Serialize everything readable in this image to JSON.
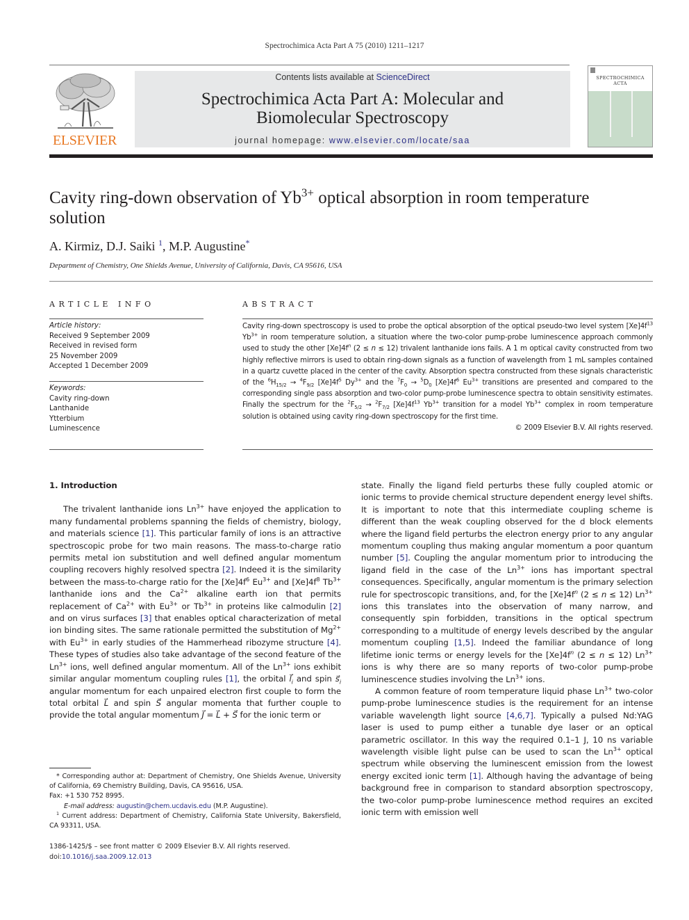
{
  "header": {
    "citation": "Spectrochimica Acta Part A 75 (2010) 1211–1217",
    "publisher_logo_text": "ELSEVIER",
    "contents_prefix": "Contents lists available at ",
    "contents_link": "ScienceDirect",
    "journal_title_line1": "Spectrochimica Acta Part A: Molecular and",
    "journal_title_line2": "Biomolecular Spectroscopy",
    "homepage_prefix": "journal homepage: ",
    "homepage_link": "www.elsevier.com/locate/saa",
    "cover_title_line1": "SPECTROCHIMICA",
    "cover_title_line2": "ACTA"
  },
  "article": {
    "title_part1": "Cavity ring-down observation of Yb",
    "title_sup": "3+",
    "title_part2": " optical absorption in room temperature solution",
    "authors": [
      {
        "name": "A. Kirmiz",
        "mark": ""
      },
      {
        "name": "D.J. Saiki",
        "mark": "1"
      },
      {
        "name": "M.P. Augustine",
        "mark": "*"
      }
    ],
    "affiliation": "Department of Chemistry, One Shields Avenue, University of California, Davis, CA 95616, USA"
  },
  "article_info": {
    "heading": "ARTICLE INFO",
    "history_label": "Article history:",
    "history": [
      "Received 9 September 2009",
      "Received in revised form",
      "25 November 2009",
      "Accepted 1 December 2009"
    ],
    "keywords_label": "Keywords:",
    "keywords": [
      "Cavity ring-down",
      "Lanthanide",
      "Ytterbium",
      "Luminescence"
    ]
  },
  "abstract": {
    "heading": "ABSTRACT",
    "t1": "Cavity ring-down spectroscopy is used to probe the optical absorption of the optical pseudo-two level system [Xe]4f",
    "t2": " Yb",
    "t3": " in room temperature solution, a situation where the two-color pump-probe luminescence approach commonly used to study the other [Xe]4f",
    "t4": " (2 ≤ ",
    "t5": " ≤ 12) trivalent lanthanide ions fails. A 1 m optical cavity constructed from two highly reflective mirrors is used to obtain ring-down signals as a function of wavelength from 1 mL samples contained in a quartz cuvette placed in the center of the cavity. Absorption spectra constructed from these signals characteristic of the ",
    "t6": " → ",
    "t7": " [Xe]4f",
    "t8": " Dy",
    "t9": " and the ",
    "t10": " [Xe]4f",
    "t11": " Eu",
    "t12": " transitions are presented and compared to the corresponding single pass absorption and two-color pump-probe luminescence spectra to obtain sensitivity estimates. Finally the spectrum for the ",
    "t13": " [Xe]4f",
    "t14": " Yb",
    "t15": " transition for a model Yb",
    "t16": " complex in room temperature solution is obtained using cavity ring-down spectroscopy for the first time.",
    "copyright": "© 2009 Elsevier B.V. All rights reserved."
  },
  "body": {
    "section_heading": "1.  Introduction",
    "left": {
      "a1": "The trivalent lanthanide ions Ln",
      "a2": " have enjoyed the application to many fundamental problems spanning the fields of chemistry, biology, and materials science ",
      "ref1": "[1]",
      "a3": ". This particular family of ions is an attractive spectroscopic probe for two main reasons. The mass-to-charge ratio permits metal ion substitution and well defined angular momentum coupling recovers highly resolved spectra ",
      "ref2": "[2]",
      "a4": ". Indeed it is the similarity between the mass-to-charge ratio for the [Xe]4f",
      "a5": " Eu",
      "a6": " and [Xe]4f",
      "a7": " Tb",
      "a8": " lanthanide ions and the Ca",
      "a9": " alkaline earth ion that permits replacement of Ca",
      "a10": " with Eu",
      "a11": " or Tb",
      "a12": " in proteins like calmodulin ",
      "ref3": "[2]",
      "a13": " and on virus surfaces ",
      "ref4": "[3]",
      "a14": " that enables optical characterization of metal ion binding sites. The same rationale permitted the substitution of Mg",
      "a15": " with Eu",
      "a16": " in early studies of the Hammerhead ribozyme structure ",
      "ref5": "[4]",
      "a17": ". These types of studies also take advantage of the second feature of the Ln",
      "a18": " ions, well defined angular momentum. All of the Ln",
      "a19": " ions exhibit similar angular momentum coupling rules ",
      "ref6": "[1]",
      "a20": ", the orbital ",
      "a21": " and spin ",
      "a22": " angular momentum for each unpaired electron first couple to form the total orbital ",
      "a23": " and spin ",
      "a24": " angular momenta that further couple to provide the total angular momentum ",
      "a25": " for the ionic term or"
    },
    "right": {
      "b1": "state. Finally the ligand field perturbs these fully coupled atomic or ionic terms to provide chemical structure dependent energy level shifts. It is important to note that this intermediate coupling scheme is different than the weak coupling observed for the d block elements where the ligand field perturbs the electron energy prior to any angular momentum coupling thus making angular momentum a poor quantum number ",
      "ref1": "[5]",
      "b2": ". Coupling the angular momentum prior to introducing the ligand field in the case of the Ln",
      "b3": " ions has important spectral consequences. Specifically, angular momentum is the primary selection rule for spectroscopic transitions, and, for the [Xe]4f",
      "b4": " (2 ≤ ",
      "b5": " ≤ 12) Ln",
      "b6": " ions this translates into the observation of many narrow, and consequently spin forbidden, transitions in the optical spectrum corresponding to a multitude of energy levels described by the angular momentum coupling ",
      "ref2": "[1,5]",
      "b7": ". Indeed the familiar abundance of long lifetime ionic terms or energy levels for the [Xe]4f",
      "b8": " (2 ≤ ",
      "b9": " ≤ 12) Ln",
      "b10": " ions is why there are so many reports of two-color pump-probe luminescence studies involving the Ln",
      "b11": " ions.",
      "c1": "A common feature of room temperature liquid phase Ln",
      "c2": " two-color pump-probe luminescence studies is the requirement for an intense variable wavelength light source ",
      "ref3": "[4,6,7]",
      "c3": ". Typically a pulsed Nd:YAG laser is used to pump either a tunable dye laser or an optical parametric oscillator. In this way the required 0.1–1 J, 10 ns variable wavelength visible light pulse can be used to scan the Ln",
      "c4": " optical spectrum while observing the luminescent emission from the lowest energy excited ionic term ",
      "ref4": "[1]",
      "c5": ". Although having the advantage of being background free in comparison to standard absorption spectroscopy, the two-color pump-probe luminescence method requires an excited ionic term with emission well"
    }
  },
  "footnotes": {
    "corresponding": "* Corresponding author at: Department of Chemistry, One Shields Avenue, University of California, 69 Chemistry Building, Davis, CA 95616, USA.",
    "fax": "Fax: +1 530 752 8995.",
    "email_label": "E-mail address: ",
    "email": "augustin@chem.ucdavis.edu",
    "email_suffix": " (M.P. Augustine).",
    "current_address_mark": "1",
    "current_address": " Current address: Department of Chemistry, California State University, Bakersfield, CA 93311, USA.",
    "front_matter": "1386-1425/$ – see front matter © 2009 Elsevier B.V. All rights reserved.",
    "doi_label": "doi:",
    "doi": "10.1016/j.saa.2009.12.013"
  }
}
